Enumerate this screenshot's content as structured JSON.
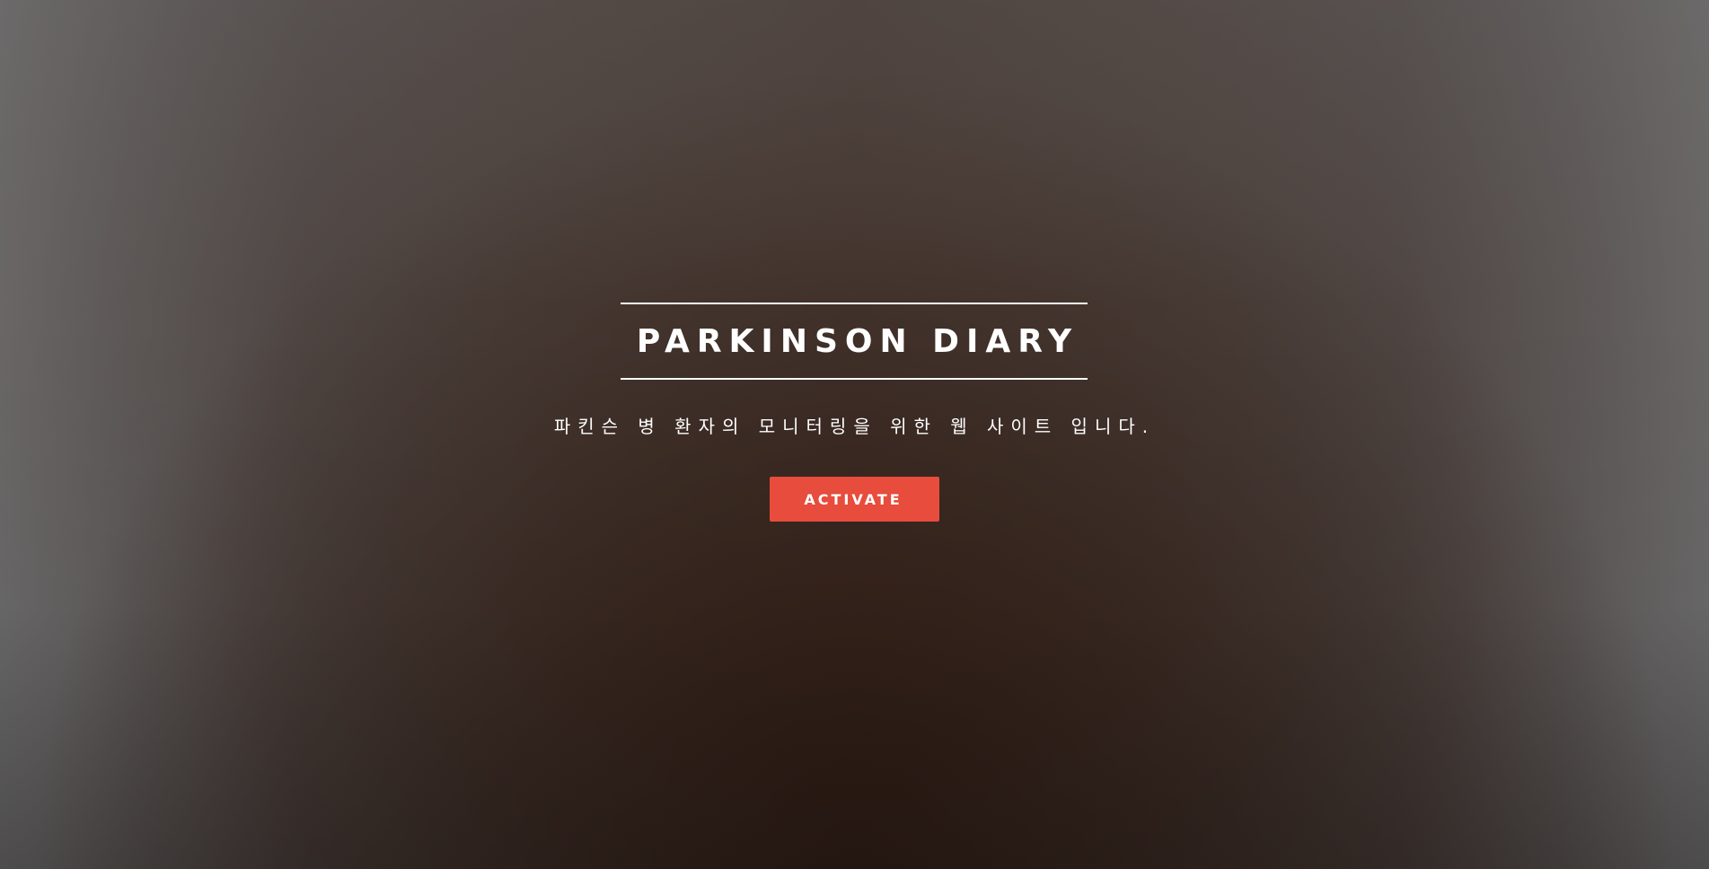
{
  "hero": {
    "title": "PARKINSON DIARY",
    "subtitle": "파킨슨 병 환자의 모니터링을 위한 웹 사이트 입니다.",
    "cta_label": "ACTIVATE"
  },
  "colors": {
    "accent": "#e74c3c",
    "text": "#ffffff",
    "background_center": "#2e1c14",
    "background_edge": "#6c6b6b"
  }
}
